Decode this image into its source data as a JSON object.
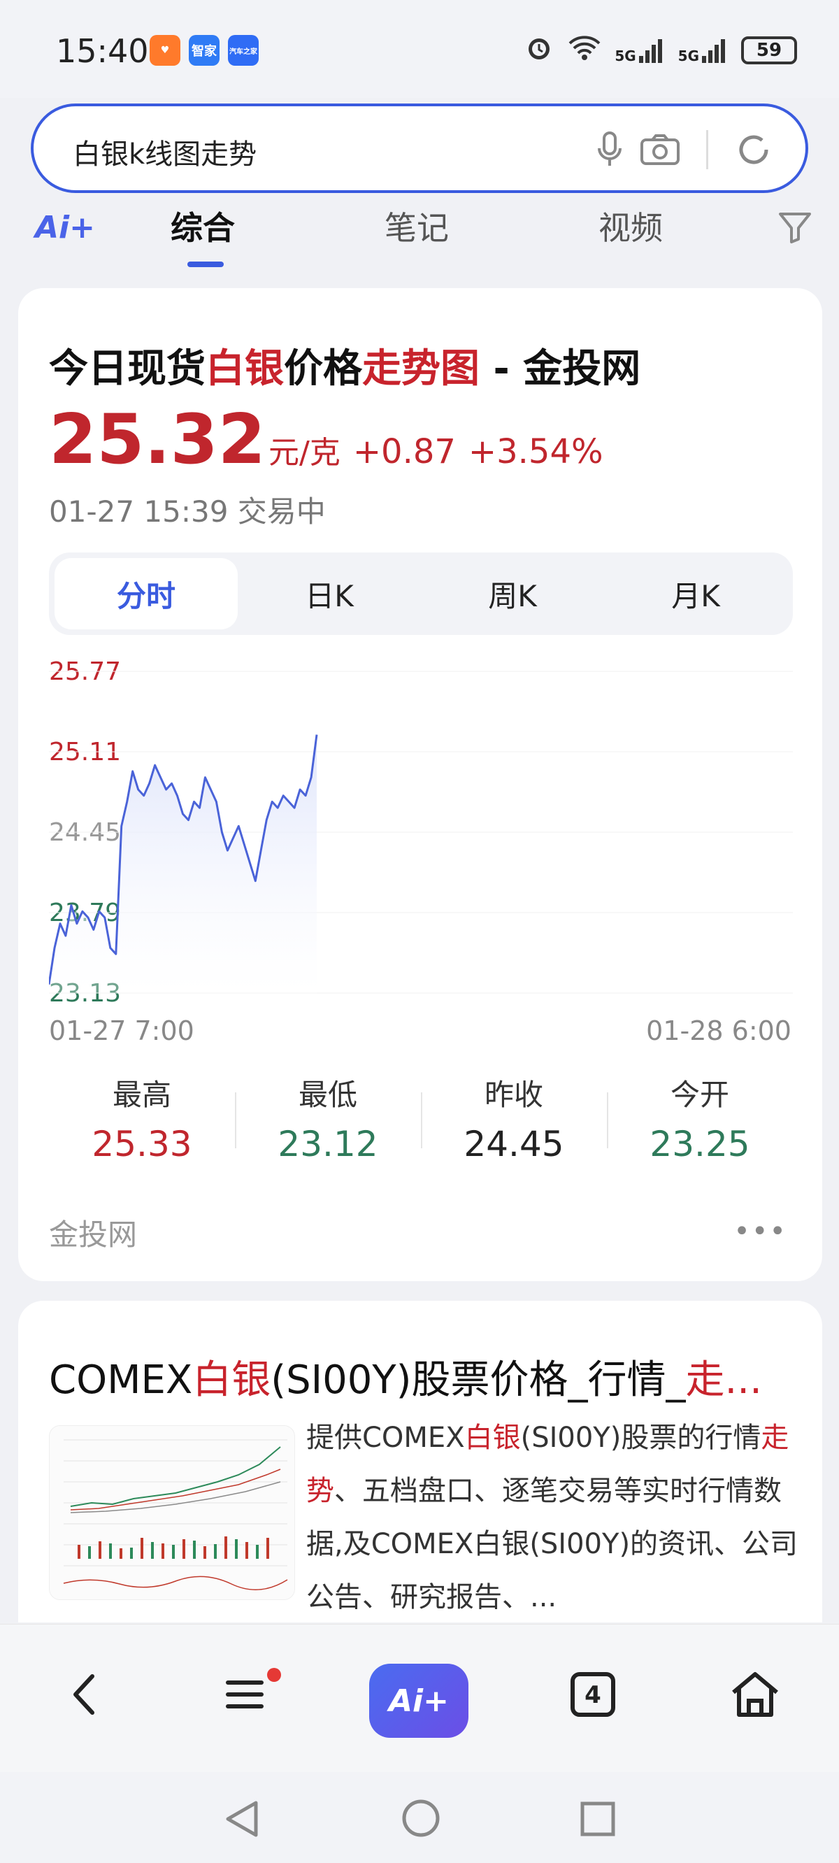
{
  "status_bar": {
    "time": "15:40",
    "app_icons": [
      {
        "name": "taobao-icon",
        "color": "#ff7a2b"
      },
      {
        "name": "smart-home-icon",
        "color": "#2f7bf5",
        "label": "智家"
      },
      {
        "name": "autohome-icon",
        "color": "#2f6cf5",
        "label": "汽车之家"
      }
    ],
    "network_1": "5G",
    "network_2": "5G",
    "battery": "59"
  },
  "search": {
    "query": "白银k线图走势"
  },
  "tabs": {
    "ai_label": "Ai+",
    "items": [
      {
        "label": "综合",
        "active": true
      },
      {
        "label": "笔记",
        "active": false
      },
      {
        "label": "视频",
        "active": false
      }
    ]
  },
  "result1": {
    "title_parts": [
      "今日现货",
      "白银",
      "价格",
      "走势图",
      " - 金投网"
    ],
    "price": "25.32",
    "unit": "元/克",
    "change": "+0.87",
    "change_pct": "+3.54%",
    "meta": "01-27 15:39  交易中",
    "segments": [
      {
        "label": "分时",
        "active": true
      },
      {
        "label": "日K",
        "active": false
      },
      {
        "label": "周K",
        "active": false
      },
      {
        "label": "月K",
        "active": false
      }
    ],
    "stats": [
      {
        "label": "最高",
        "value": "25.33",
        "color": "red"
      },
      {
        "label": "最低",
        "value": "23.12",
        "color": "green"
      },
      {
        "label": "昨收",
        "value": "24.45",
        "color": "dark"
      },
      {
        "label": "今开",
        "value": "23.25",
        "color": "green"
      }
    ],
    "source": "金投网"
  },
  "chart_data": {
    "type": "area",
    "y_ticks": [
      "25.77",
      "25.11",
      "24.45",
      "23.79",
      "23.13"
    ],
    "ylim": [
      23.13,
      25.77
    ],
    "x_start_label": "01-27 7:00",
    "x_end_label": "01-28 6:00",
    "y_values": [
      23.2,
      23.5,
      23.7,
      23.6,
      23.85,
      23.7,
      23.8,
      23.75,
      23.65,
      23.8,
      23.75,
      23.5,
      23.45,
      24.5,
      24.7,
      24.95,
      24.8,
      24.75,
      24.85,
      25.0,
      24.9,
      24.8,
      24.85,
      24.75,
      24.6,
      24.55,
      24.7,
      24.65,
      24.9,
      24.8,
      24.7,
      24.45,
      24.3,
      24.4,
      24.5,
      24.35,
      24.2,
      24.05,
      24.3,
      24.55,
      24.7,
      24.65,
      24.75,
      24.7,
      24.65,
      24.8,
      24.75,
      24.9,
      25.25
    ],
    "line_color": "#4a63d8",
    "fill_color": "#dfe5fb",
    "up_color": "#c0262d",
    "down_color": "#2e7a5a"
  },
  "result2": {
    "title_parts": [
      "COMEX",
      "白银",
      "(SI00Y)股票价格_行情_",
      "走..."
    ],
    "snippet_parts": [
      "提供COMEX",
      "白银",
      "(SI00Y)股票的行情",
      "走势",
      "、五档盘口、逐笔交易等实时行情数据,及COMEX白银(SI00Y)的资讯、公司公告、研究报告、..."
    ]
  },
  "bottom_nav": {
    "ai_label": "Ai+",
    "tab_count": "4"
  }
}
